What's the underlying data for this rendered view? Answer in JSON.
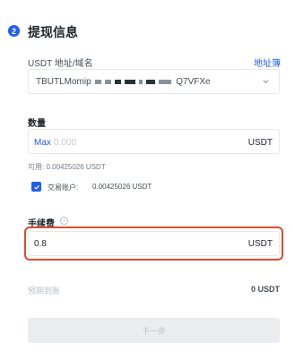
{
  "section": {
    "step": "2",
    "title": "提现信息"
  },
  "address": {
    "label": "USDT 地址/域名",
    "book_link": "地址簿",
    "value_start": "TBUTLMomip",
    "value_end": "Q7VFXe"
  },
  "amount": {
    "label": "数量",
    "max_label": "Max",
    "placeholder": "0.000",
    "unit": "USDT",
    "available": "可用: 0.00425026 USDT",
    "trade_account_label": "交易账户:",
    "trade_account_value": "0.00425026 USDT"
  },
  "fee": {
    "label": "手续费",
    "info_icon": "i",
    "value": "0.8",
    "unit": "USDT",
    "highlight_color": "#e04a2f"
  },
  "arrival": {
    "label": "预期到账",
    "value": "0 USDT"
  },
  "next_button": "下一步"
}
